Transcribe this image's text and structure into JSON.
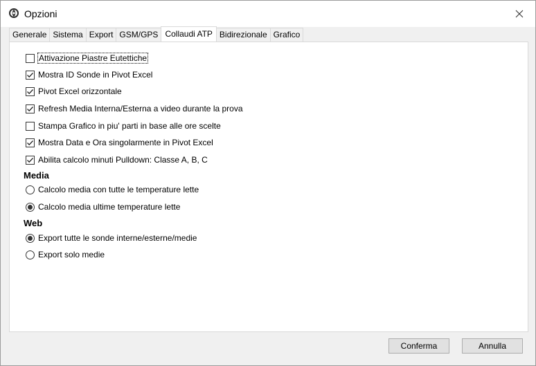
{
  "window": {
    "title": "Opzioni"
  },
  "tabs": [
    {
      "label": "Generale",
      "active": false
    },
    {
      "label": "Sistema",
      "active": false
    },
    {
      "label": "Export",
      "active": false
    },
    {
      "label": "GSM/GPS",
      "active": false
    },
    {
      "label": "Collaudi ATP",
      "active": true
    },
    {
      "label": "Bidirezionale",
      "active": false
    },
    {
      "label": "Grafico",
      "active": false
    }
  ],
  "checkboxes": [
    {
      "label": "Attivazione Piastre Eutettiche",
      "checked": false
    },
    {
      "label": "Mostra ID Sonde in Pivot Excel",
      "checked": true
    },
    {
      "label": "Pivot Excel orizzontale",
      "checked": true
    },
    {
      "label": "Refresh Media Interna/Esterna a video durante la prova",
      "checked": true
    },
    {
      "label": "Stampa Grafico in piu' parti in base alle ore scelte",
      "checked": false
    },
    {
      "label": "Mostra Data e Ora singolarmente in Pivot Excel",
      "checked": true
    },
    {
      "label": "Abilita calcolo minuti Pulldown: Classe A, B, C",
      "checked": true
    }
  ],
  "media": {
    "heading": "Media",
    "options": [
      {
        "label": "Calcolo media con tutte le temperature lette",
        "selected": false
      },
      {
        "label": "Calcolo media ultime temperature lette",
        "selected": true
      }
    ]
  },
  "web": {
    "heading": "Web",
    "options": [
      {
        "label": "Export tutte le sonde interne/esterne/medie",
        "selected": true
      },
      {
        "label": "Export solo medie",
        "selected": false
      }
    ]
  },
  "buttons": {
    "confirm": "Conferma",
    "cancel": "Annulla"
  }
}
